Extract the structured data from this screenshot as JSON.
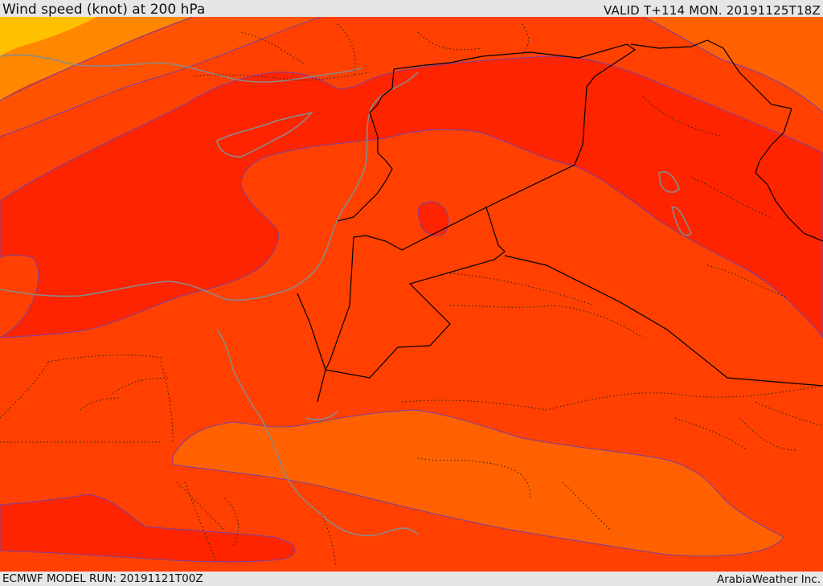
{
  "header": {
    "title": "Wind speed (knot) at 200 hPa",
    "valid": "VALID T+114 MON. 20191125T18Z"
  },
  "footer": {
    "model_run": "ECMWF MODEL RUN: 20191121T00Z",
    "credit": "ArabiaWeather Inc."
  },
  "map": {
    "colors": {
      "band_yellow": "#ffc000",
      "band_light_orange": "#ff8800",
      "band_orange": "#ff6000",
      "band_red_orange": "#ff4000",
      "band_red": "#ff2400",
      "contour_line": "#7a3fa0",
      "coastline": "#8a8a8a",
      "border": "#000000"
    }
  }
}
